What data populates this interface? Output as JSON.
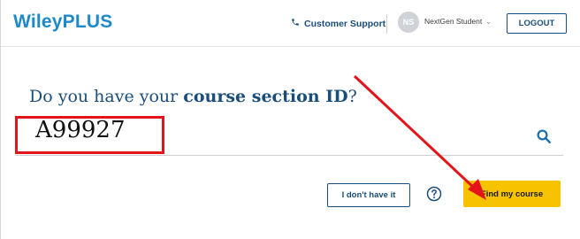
{
  "header": {
    "logo_text": "WileyPLUS",
    "support_label": "Customer Support",
    "avatar_initials": "NS",
    "student_name": "NextGen Student",
    "logout_label": "LOGOUT"
  },
  "main": {
    "question_prefix": "Do you have your ",
    "question_bold": "course section ID",
    "question_suffix": "?",
    "course_id_value": "A99927",
    "no_id_label": "I don't have it",
    "find_course_label": "Find my course"
  },
  "colors": {
    "brand_blue": "#1d8ac7",
    "navy": "#1a4e7a",
    "accent_yellow": "#f7c300",
    "annotation_red": "#e3151a"
  },
  "icons": [
    "phone-icon",
    "chevron-down-icon",
    "search-icon",
    "help-icon"
  ]
}
